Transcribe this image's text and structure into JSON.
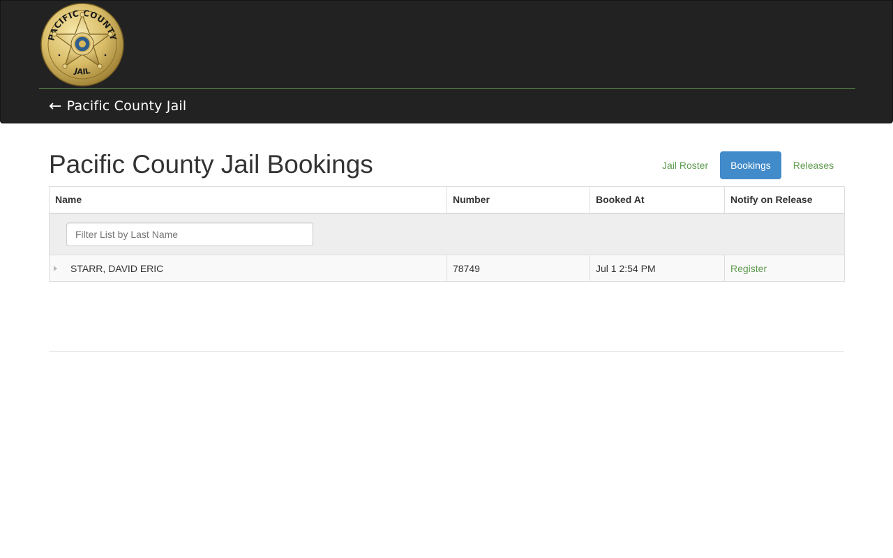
{
  "header": {
    "logo": {
      "icon": "sheriff-star-badge",
      "top_text": "PACIFIC COUNTY",
      "bottom_text": "JAIL"
    },
    "back_arrow": "←",
    "back_link_label": "Pacific County Jail"
  },
  "page": {
    "title": "Pacific County Jail Bookings"
  },
  "nav": {
    "pills": [
      {
        "label": "Jail Roster",
        "active": false
      },
      {
        "label": "Bookings",
        "active": true
      },
      {
        "label": "Releases",
        "active": false
      }
    ]
  },
  "table": {
    "columns": [
      "Name",
      "Number",
      "Booked At",
      "Notify on Release"
    ],
    "filter": {
      "placeholder": "Filter List by Last Name",
      "value": ""
    },
    "rows": [
      {
        "name": "STARR, DAVID ERIC",
        "number": "78749",
        "booked_at": "Jul 1 2:54 PM",
        "notify_label": "Register"
      }
    ]
  },
  "colors": {
    "header_bg": "#222222",
    "accent_green": "#5e9a4d",
    "active_pill_bg": "#428bca",
    "badge_gold": "#d8bf6a"
  }
}
